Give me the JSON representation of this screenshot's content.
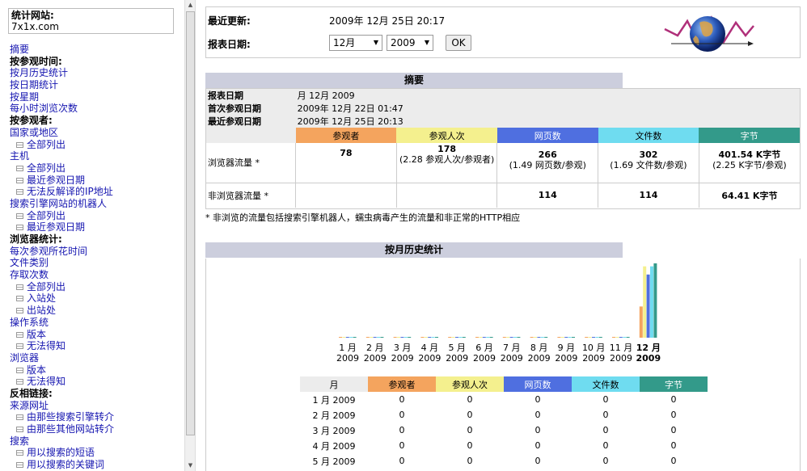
{
  "sidebar": {
    "site_label": "统计网站:",
    "site_value": "7x1x.com",
    "items": [
      {
        "label": "摘要",
        "kind": "link"
      },
      {
        "label": "按参观时间:",
        "kind": "bold"
      },
      {
        "label": "按月历史统计",
        "kind": "link"
      },
      {
        "label": "按日期统计",
        "kind": "link"
      },
      {
        "label": "按星期",
        "kind": "link"
      },
      {
        "label": "每小时浏览次数",
        "kind": "link"
      },
      {
        "label": "按参观者:",
        "kind": "bold"
      },
      {
        "label": "国家或地区",
        "kind": "link"
      },
      {
        "label": "全部列出",
        "kind": "sub"
      },
      {
        "label": "主机",
        "kind": "link"
      },
      {
        "label": "全部列出",
        "kind": "sub"
      },
      {
        "label": "最近参观日期",
        "kind": "sub"
      },
      {
        "label": "无法反解译的IP地址",
        "kind": "sub"
      },
      {
        "label": "搜索引擎网站的机器人",
        "kind": "link"
      },
      {
        "label": "全部列出",
        "kind": "sub"
      },
      {
        "label": "最近参观日期",
        "kind": "sub"
      },
      {
        "label": "浏览器统计:",
        "kind": "bold"
      },
      {
        "label": "每次参观所花时间",
        "kind": "link"
      },
      {
        "label": "文件类别",
        "kind": "link"
      },
      {
        "label": "存取次数",
        "kind": "link"
      },
      {
        "label": "全部列出",
        "kind": "sub"
      },
      {
        "label": "入站处",
        "kind": "sub"
      },
      {
        "label": "出站处",
        "kind": "sub"
      },
      {
        "label": "操作系统",
        "kind": "link"
      },
      {
        "label": "版本",
        "kind": "sub"
      },
      {
        "label": "无法得知",
        "kind": "sub"
      },
      {
        "label": "浏览器",
        "kind": "link"
      },
      {
        "label": "版本",
        "kind": "sub"
      },
      {
        "label": "无法得知",
        "kind": "sub"
      },
      {
        "label": "反相链接:",
        "kind": "bold"
      },
      {
        "label": "来源网址",
        "kind": "link"
      },
      {
        "label": "由那些搜索引擎转介",
        "kind": "sub"
      },
      {
        "label": "由那些其他网站转介",
        "kind": "sub"
      },
      {
        "label": "搜索",
        "kind": "link"
      },
      {
        "label": "用以搜索的短语",
        "kind": "sub"
      },
      {
        "label": "用以搜索的关键词",
        "kind": "sub"
      }
    ]
  },
  "header": {
    "last_update_label": "最近更新:",
    "last_update_value": "2009年 12月 25日 20:17",
    "report_date_label": "报表日期:",
    "month_selected": "12月",
    "year_selected": "2009",
    "ok_label": "OK"
  },
  "summary": {
    "title": "摘要",
    "period_label": "报表日期",
    "period_value": "月 12月 2009",
    "first_label": "首次参观日期",
    "first_value": "2009年 12月 22日 01:47",
    "last_label": "最近参观日期",
    "last_value": "2009年 12月 25日 20:13",
    "col_visitors": "参观者",
    "col_visits": "参观人次",
    "col_pages": "网页数",
    "col_files": "文件数",
    "col_bytes": "字节",
    "row1_label": "浏览器流量 *",
    "row1_visitors": "78",
    "row1_visits": "178",
    "row1_visits_sub": "(2.28 参观人次/参观者)",
    "row1_pages": "266",
    "row1_pages_sub": "(1.49 网页数/参观)",
    "row1_files": "302",
    "row1_files_sub": "(1.69 文件数/参观)",
    "row1_bytes": "401.54 K字节",
    "row1_bytes_sub": "(2.25 K字节/参观)",
    "row2_label": "非浏览器流量 *",
    "row2_pages": "114",
    "row2_files": "114",
    "row2_bytes": "64.41 K字节",
    "note": "* 非浏览的流量包括搜索引擎机器人，蠕虫病毒产生的流量和非正常的HTTP相应"
  },
  "monthly": {
    "title": "按月历史统计",
    "col_month": "月",
    "col_visitors": "参观者",
    "col_visits": "参观人次",
    "col_pages": "网页数",
    "col_files": "文件数",
    "col_bytes": "字节",
    "rows": [
      {
        "month": "1 月  2009",
        "v": "0",
        "vi": "0",
        "p": "0",
        "f": "0",
        "b": "0"
      },
      {
        "month": "2 月  2009",
        "v": "0",
        "vi": "0",
        "p": "0",
        "f": "0",
        "b": "0"
      },
      {
        "month": "3 月  2009",
        "v": "0",
        "vi": "0",
        "p": "0",
        "f": "0",
        "b": "0"
      },
      {
        "month": "4 月  2009",
        "v": "0",
        "vi": "0",
        "p": "0",
        "f": "0",
        "b": "0"
      },
      {
        "month": "5 月  2009",
        "v": "0",
        "vi": "0",
        "p": "0",
        "f": "0",
        "b": "0"
      }
    ]
  },
  "chart_data": {
    "type": "bar",
    "categories": [
      "1 月 2009",
      "2 月 2009",
      "3 月 2009",
      "4 月 2009",
      "5 月 2009",
      "6 月 2009",
      "7 月 2009",
      "8 月 2009",
      "9 月 2009",
      "10 月 2009",
      "11 月 2009",
      "12 月 2009"
    ],
    "month_labels": [
      "1 月",
      "2 月",
      "3 月",
      "4 月",
      "5 月",
      "6 月",
      "7 月",
      "8 月",
      "9 月",
      "10 月",
      "11 月",
      "12 月"
    ],
    "year_label": "2009",
    "series": [
      {
        "name": "参观者",
        "color": "#f4a45e",
        "values": [
          0,
          0,
          0,
          0,
          0,
          0,
          0,
          0,
          0,
          0,
          0,
          78
        ]
      },
      {
        "name": "参观人次",
        "color": "#f4f08e",
        "values": [
          0,
          0,
          0,
          0,
          0,
          0,
          0,
          0,
          0,
          0,
          0,
          178
        ]
      },
      {
        "name": "网页数",
        "color": "#4f6fe0",
        "values": [
          0,
          0,
          0,
          0,
          0,
          0,
          0,
          0,
          0,
          0,
          0,
          380
        ]
      },
      {
        "name": "文件数",
        "color": "#6fdcf0",
        "values": [
          0,
          0,
          0,
          0,
          0,
          0,
          0,
          0,
          0,
          0,
          0,
          416
        ]
      },
      {
        "name": "字节",
        "color": "#339a8a",
        "values": [
          0,
          0,
          0,
          0,
          0,
          0,
          0,
          0,
          0,
          0,
          0,
          465.95
        ]
      }
    ]
  }
}
